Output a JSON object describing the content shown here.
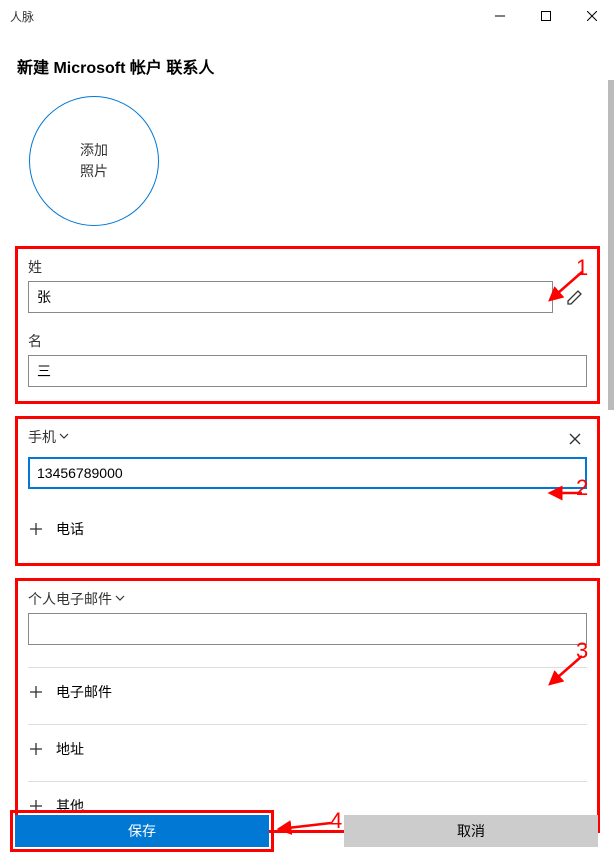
{
  "window": {
    "title": "人脉"
  },
  "header": {
    "title": "新建 Microsoft 帐户 联系人"
  },
  "photo": {
    "label": "添加\n照片"
  },
  "name_section": {
    "lastname_label": "姓",
    "lastname_value": "张",
    "firstname_label": "名",
    "firstname_value": "三"
  },
  "phone_section": {
    "type_label": "手机",
    "value": "13456789000",
    "add_label": "电话"
  },
  "email_section": {
    "type_label": "个人电子邮件",
    "value": "",
    "add_email_label": "电子邮件",
    "add_address_label": "地址",
    "add_other_label": "其他"
  },
  "footer": {
    "save_label": "保存",
    "cancel_label": "取消"
  },
  "annotations": {
    "n1": "1",
    "n2": "2",
    "n3": "3",
    "n4": "4"
  }
}
